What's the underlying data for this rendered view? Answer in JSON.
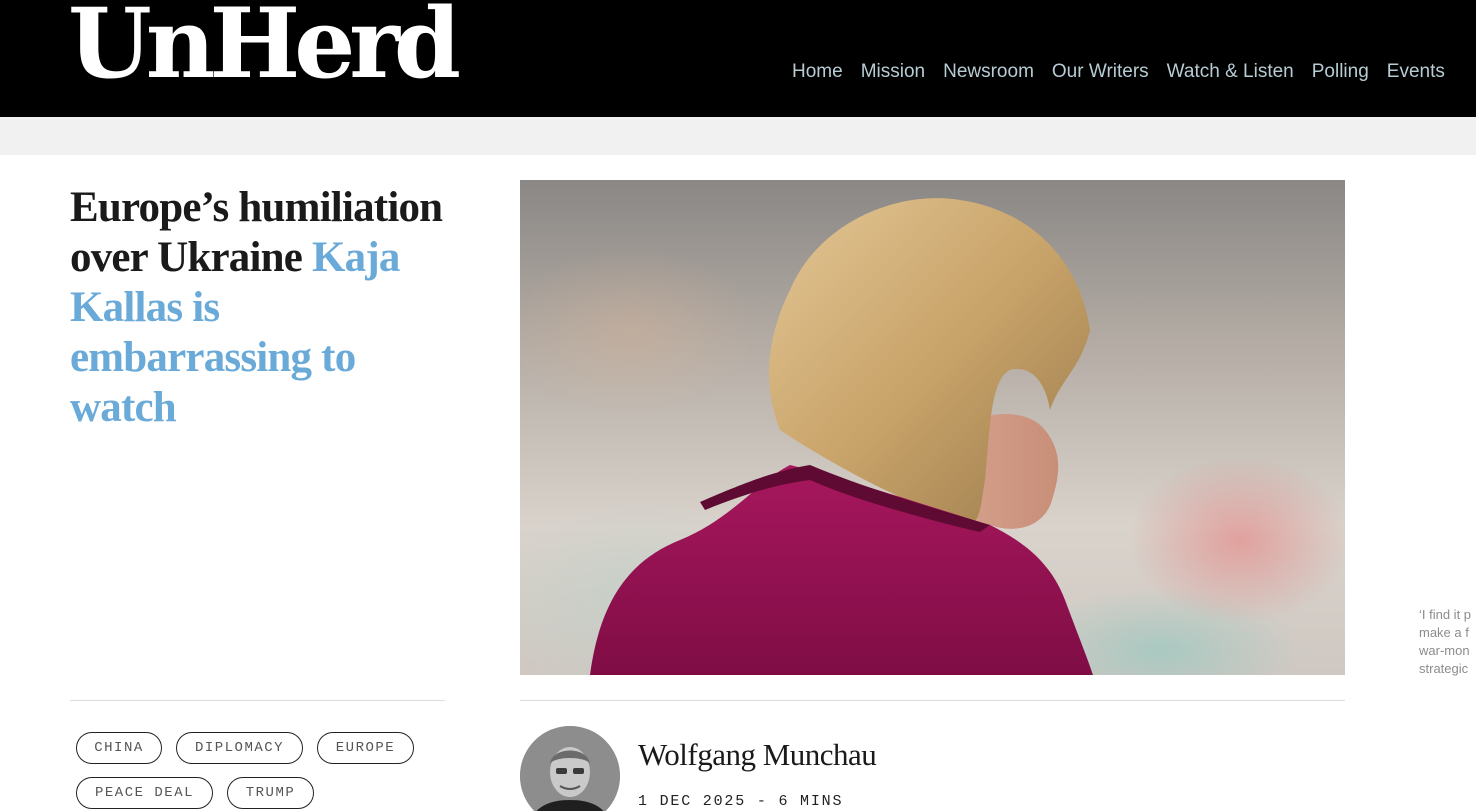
{
  "header": {
    "logo_text": "UnHerd",
    "nav": [
      "Home",
      "Mission",
      "Newsroom",
      "Our Writers",
      "Watch & Listen",
      "Polling",
      "Events"
    ]
  },
  "article": {
    "headline_part1": "Europe’s humiliation over Ukraine",
    "headline_part2": "Kaja Kallas is embarrassing to watch",
    "hero_image_alt": "Woman with blonde bob in magenta jacket",
    "pull_quote_lines": [
      "‘I find it p",
      "make a f",
      "war-mon",
      "strategic"
    ],
    "tags": [
      "CHINA",
      "DIPLOMACY",
      "EUROPE",
      "PEACE DEAL",
      "TRUMP"
    ],
    "author": {
      "name": "Wolfgang Munchau",
      "date": "1 DEC 2025",
      "separator": "-",
      "read_time": "6 MINS"
    }
  },
  "colors": {
    "header_bg": "#000000",
    "nav_text": "#b7ccd3",
    "accent_blue": "#6aaad8",
    "band_grey": "#f1f1f1"
  }
}
